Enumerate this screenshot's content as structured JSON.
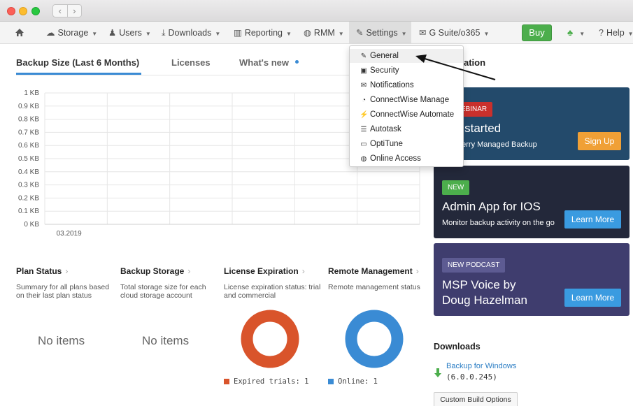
{
  "window": {
    "back_glyph": "‹",
    "forward_glyph": "›"
  },
  "nav": {
    "home_icon": "home-icon",
    "items": [
      {
        "label": "Storage",
        "icon": "cloud-icon"
      },
      {
        "label": "Users",
        "icon": "user-icon"
      },
      {
        "label": "Downloads",
        "icon": "download-icon"
      },
      {
        "label": "Reporting",
        "icon": "bar-chart-icon"
      },
      {
        "label": "RMM",
        "icon": "globe-icon"
      },
      {
        "label": "Settings",
        "icon": "wrench-icon"
      },
      {
        "label": "G Suite/o365",
        "icon": "envelope-icon"
      }
    ],
    "buy_label": "Buy",
    "help_label": "Help"
  },
  "tabs": [
    {
      "label": "Backup Size (Last 6 Months)",
      "active": true
    },
    {
      "label": "Licenses",
      "active": false
    },
    {
      "label": "What's new",
      "active": false
    }
  ],
  "chart_data": {
    "type": "bar",
    "categories": [
      "03.2019"
    ],
    "values": [
      0
    ],
    "yticks": [
      "0 KB",
      "0.1 KB",
      "0.2 KB",
      "0.3 KB",
      "0.4 KB",
      "0.5 KB",
      "0.6 KB",
      "0.7 KB",
      "0.8 KB",
      "0.9 KB",
      "1 KB"
    ],
    "ylim": [
      0,
      1
    ],
    "grid": true
  },
  "sections": [
    {
      "title": "Plan Status",
      "desc": "Summary for all plans based on their last plan status",
      "empty": "No items"
    },
    {
      "title": "Backup Storage",
      "desc": "Total storage size for each cloud storage account",
      "empty": "No items"
    },
    {
      "title": "License Expiration",
      "desc": "License expiration status: trial and commercial",
      "legend": "Expired trials: 1",
      "color": "#d9542b"
    },
    {
      "title": "Remote Management",
      "desc": "Remote management status",
      "legend": "Online: 1",
      "color": "#3a8bd4"
    }
  ],
  "settings_menu": {
    "items": [
      {
        "label": "General",
        "icon": "wrench-icon"
      },
      {
        "label": "Security",
        "icon": "lock-icon"
      },
      {
        "label": "Notifications",
        "icon": "envelope-icon"
      },
      {
        "label": "ConnectWise Manage",
        "icon": "rss-icon"
      },
      {
        "label": "ConnectWise Automate",
        "icon": "plug-icon"
      },
      {
        "label": "Autotask",
        "icon": "list-icon"
      },
      {
        "label": "OptiTune",
        "icon": "monitor-icon"
      },
      {
        "label": "Online Access",
        "icon": "globe-icon"
      }
    ]
  },
  "right": {
    "partial_title": "ation",
    "cards": [
      {
        "badge": "E WEBINAR",
        "heading": "ting started",
        "sub": "loudBerry Managed Backup",
        "button": "Sign Up",
        "bg": "#234a6b",
        "badge_bg": "#c9302c",
        "btn_bg": "#f0a036"
      },
      {
        "badge": "NEW",
        "heading": "Admin App for IOS",
        "sub": "Monitor backup activity on the go",
        "button": "Learn More",
        "bg": "#23283a",
        "badge_bg": "#4cae4c",
        "btn_bg": "#3a9be0"
      },
      {
        "badge": "NEW PODCAST",
        "heading": "MSP Voice by Doug Hazelman",
        "sub": "",
        "button": "Learn More",
        "bg": "#3f3d6e",
        "badge_bg": "#5d5b92",
        "btn_bg": "#3a9be0"
      }
    ],
    "downloads": {
      "title": "Downloads",
      "link": "Backup for Windows",
      "version": "(6.0.0.245)",
      "custom_button": "Custom Build Options"
    }
  }
}
